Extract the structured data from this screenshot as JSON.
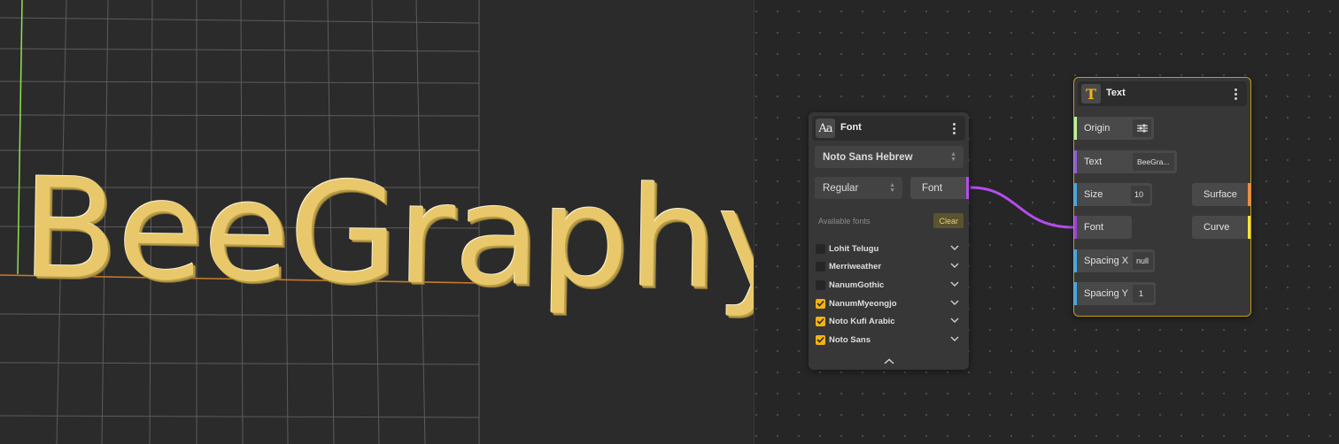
{
  "viewport": {
    "text3d": "BeeGraphy"
  },
  "font_node": {
    "title": "Font",
    "family_select": "Noto Sans Hebrew",
    "style_select": "Regular",
    "output_label": "Font",
    "available_label": "Available fonts",
    "clear_label": "Clear",
    "fonts": [
      {
        "name": "Lohit Telugu",
        "checked": false
      },
      {
        "name": "Merriweather",
        "checked": false
      },
      {
        "name": "NanumGothic",
        "checked": false
      },
      {
        "name": "NanumMyeongjo",
        "checked": true
      },
      {
        "name": "Noto Kufi Arabic",
        "checked": true
      },
      {
        "name": "Noto Sans",
        "checked": true
      }
    ]
  },
  "text_node": {
    "title": "Text",
    "inputs": [
      {
        "label": "Origin",
        "value": "",
        "color": "#b5f59a"
      },
      {
        "label": "Text",
        "value": "BeeGra...",
        "color": "#8a5ce0"
      },
      {
        "label": "Size",
        "value": "10",
        "color": "#3ea7f0"
      },
      {
        "label": "Font",
        "value": "",
        "color": "#9b3fe0"
      },
      {
        "label": "Spacing X",
        "value": "null",
        "color": "#3ea7f0"
      },
      {
        "label": "Spacing Y",
        "value": "1",
        "color": "#3ea7f0"
      }
    ],
    "outputs": [
      {
        "label": "Surface",
        "color": "#ee8a4d"
      },
      {
        "label": "Curve",
        "color": "#f5e43c"
      }
    ]
  },
  "colors": {
    "accent": "#f2b313",
    "text_gold": "#e8c86a",
    "wire": "#b44dec"
  }
}
